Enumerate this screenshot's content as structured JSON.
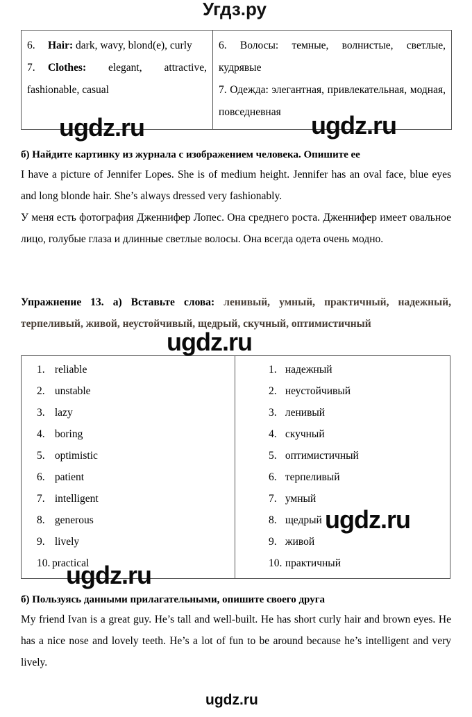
{
  "site": {
    "logo": "Угдз.ру",
    "watermark": "ugdz.ru"
  },
  "colors": {
    "word_list_accent": "#4a4038",
    "table_border": "#555555",
    "text": "#000000"
  },
  "top_table": {
    "rows": [
      {
        "en_num": "6.",
        "en_label": "Hair:",
        "en_text": "dark, wavy, blond(e), curly",
        "ru_num": "6.",
        "ru_label": "Волосы:",
        "ru_text": "темные, волнистые, светлые, кудрявые"
      },
      {
        "en_num": "7.",
        "en_label": "Clothes:",
        "en_text": "elegant, attractive, fashionable, casual",
        "ru_num": "7.",
        "ru_label": "Одежда:",
        "ru_text": "элегантная, привлекательная, модная, повседневная"
      }
    ]
  },
  "section_b1": {
    "heading": "б) Найдите картинку из журнала с изображением человека. Опишите ее",
    "english": "I have a picture of Jennifer Lopes. She is of medium height. Jennifer has an oval face, blue eyes and long blonde hair. She’s always dressed very fashionably.",
    "russian": "У меня есть фотография Дженнифер Лопес. Она среднего роста. Дженнифер имеет овальное лицо, голубые глаза и длинные светлые волосы. Она всегда одета очень модно."
  },
  "exercise13": {
    "lead": "Упражнение 13. а) Вставьте слова:",
    "words": "ленивый, умный, практичный, надежный, терпеливый, живой, неустойчивый, щедрый, скучный, оптимистичный"
  },
  "answer_table": {
    "english": [
      {
        "num": "1.",
        "word": "reliable"
      },
      {
        "num": "2.",
        "word": "unstable"
      },
      {
        "num": "3.",
        "word": "lazy"
      },
      {
        "num": "4.",
        "word": "boring"
      },
      {
        "num": "5.",
        "word": "optimistic"
      },
      {
        "num": "6.",
        "word": "patient"
      },
      {
        "num": "7.",
        "word": "intelligent"
      },
      {
        "num": "8.",
        "word": "generous"
      },
      {
        "num": "9.",
        "word": "lively"
      },
      {
        "num": "10.",
        "word": "practical"
      }
    ],
    "russian": [
      {
        "num": "1.",
        "word": "надежный"
      },
      {
        "num": "2.",
        "word": "неустойчивый"
      },
      {
        "num": "3.",
        "word": "ленивый"
      },
      {
        "num": "4.",
        "word": "скучный"
      },
      {
        "num": "5.",
        "word": "оптимистичный"
      },
      {
        "num": "6.",
        "word": "терпеливый"
      },
      {
        "num": "7.",
        "word": "умный"
      },
      {
        "num": "8.",
        "word": "щедрый"
      },
      {
        "num": "9.",
        "word": "живой"
      },
      {
        "num": "10.",
        "word": "практичный"
      }
    ]
  },
  "section_b2": {
    "heading": "б) Пользуясь данными прилагательными, опишите своего друга",
    "english": "My friend Ivan is a great guy. He’s tall and well-built. He has short curly hair and brown eyes. He has a nice nose and lovely teeth. He’s a lot of fun to be around because he’s intelligent and very lively."
  }
}
